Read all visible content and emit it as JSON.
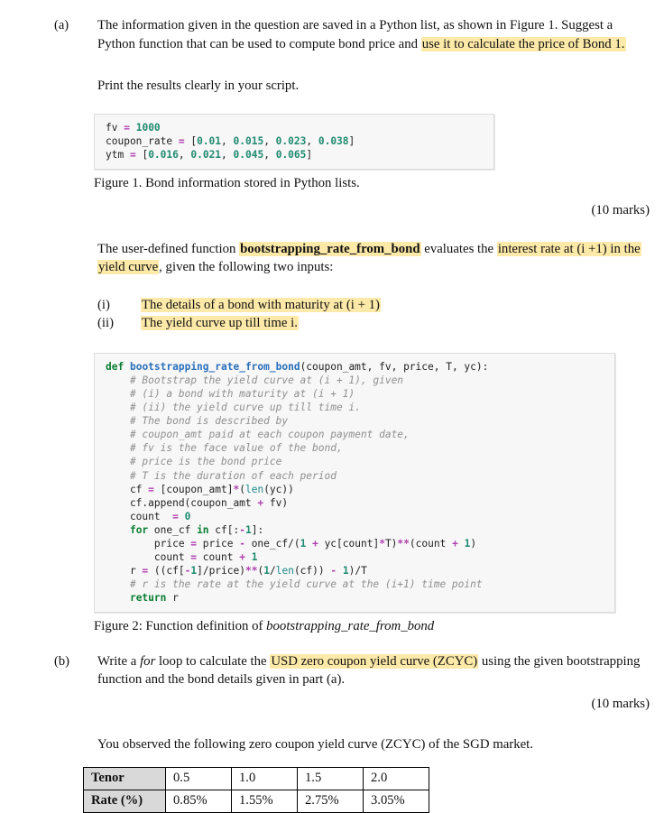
{
  "part_a": {
    "label": "(a)",
    "paragraph_1_pre": "The information given in the question are saved in a Python list, as shown in Figure 1. Suggest a Python function that can be used to compute bond price and ",
    "paragraph_1_highlight": "use it to calculate the price of Bond 1.",
    "paragraph_2": "Print the results clearly in your script.",
    "marks": "(10 marks)"
  },
  "figure1": {
    "code_lines": [
      "fv = 1000",
      "coupon_rate = [0.01, 0.015, 0.023, 0.038]",
      "ytm = [0.016, 0.021, 0.045, 0.065]"
    ],
    "caption": "Figure 1. Bond information stored in Python lists."
  },
  "intro_function": {
    "text_1": "The user-defined function ",
    "function_name": "bootstrapping_rate_from_bond",
    "text_2": " evaluates the ",
    "highlight_1": "interest rate at (i +1) in the yield curve",
    "text_3": ", given the following two inputs:"
  },
  "inputs_list": [
    {
      "num": "(i)",
      "text": "The details of a bond with maturity at (i + 1)"
    },
    {
      "num": "(ii)",
      "text": "The yield curve up till time i."
    }
  ],
  "figure2": {
    "code_lines": [
      "def bootstrapping_rate_from_bond(coupon_amt, fv, price, T, yc):",
      "    # Bootstrap the yield curve at (i + 1), given",
      "    # (i) a bond with maturity at (i + 1)",
      "    # (ii) the yield curve up till time i.",
      "    # The bond is described by",
      "    # coupon_amt paid at each coupon payment date,",
      "    # fv is the face value of the bond,",
      "    # price is the bond price",
      "    # T is the duration of each period",
      "    cf = [coupon_amt]*(len(yc))",
      "    cf.append(coupon_amt + fv)",
      "    count  = 0",
      "    for one_cf in cf[:-1]:",
      "        price = price - one_cf/(1 + yc[count]*T)**(count + 1)",
      "        count = count + 1",
      "    r = ((cf[-1]/price)**(1/len(cf)) - 1)/T",
      "    # r is the rate at the yield curve at the (i+1) time point",
      "    return r"
    ],
    "caption_pre": "Figure 2: Function definition of ",
    "caption_italic": "bootstrapping_rate_from_bond"
  },
  "part_b": {
    "label": "(b)",
    "text_1": "Write a ",
    "text_for": "for",
    "text_2": " loop to calculate the ",
    "highlight": "USD zero coupon yield curve (ZCYC)",
    "text_3": " using the given bootstrapping function and the bond details given in part (a).",
    "marks": "(10 marks)"
  },
  "observation": {
    "text": "You observed the following zero coupon yield curve (ZCYC) of the SGD market."
  },
  "zcyc_table": {
    "rows": [
      {
        "head": "Tenor",
        "values": [
          "0.5",
          "1.0",
          "1.5",
          "2.0"
        ]
      },
      {
        "head": "Rate (%)",
        "values": [
          "0.85%",
          "1.55%",
          "2.75%",
          "3.05%"
        ]
      }
    ]
  },
  "colors": {
    "highlight": "#fde9a8",
    "table_head_bg": "#d9d9d9",
    "code_bg": "#f7f7f7"
  }
}
